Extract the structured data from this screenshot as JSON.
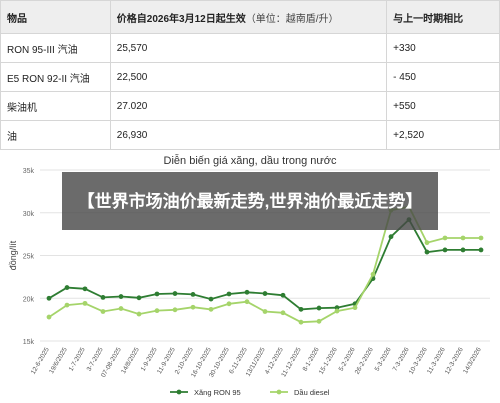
{
  "table": {
    "headers": {
      "product": "物品",
      "price": "价格自2026年3月12日起生效",
      "price_unit": "（单位：越南盾/升）",
      "change": "与上一时期相比"
    },
    "rows": [
      {
        "product": "RON 95-III 汽油",
        "price": "25,570",
        "change": "+330"
      },
      {
        "product": "E5 RON 92-II 汽油",
        "price": "22,500",
        "change": "- 450"
      },
      {
        "product": "柴油机",
        "price": "27.020",
        "change": "+550"
      },
      {
        "product": "油",
        "price": "26,930",
        "change": "+2,520"
      }
    ]
  },
  "overlay": {
    "text": "【世界市场油价最新走势,世界油价最近走势】"
  },
  "chart_data": {
    "type": "line",
    "title": "Diễn biến giá xăng, dầu trong nước",
    "ylabel": "đồng/lít",
    "xlabel": "",
    "ylim": [
      15000,
      35000
    ],
    "yticks": [
      "15k",
      "20k",
      "25k",
      "30k",
      "35k"
    ],
    "grid": true,
    "legend_position": "bottom",
    "categories": [
      "12-6-2025",
      "19/6/2025",
      "1-7-2025",
      "3-7-2025",
      "07-08-2025",
      "14/8/2025",
      "1-9-2025",
      "11-9-2025",
      "2-10-2025",
      "16-10-2025",
      "30-10-2025",
      "6-11-2025",
      "13/11/2025",
      "4-12-2025",
      "11-12-2025",
      "8-1-2026",
      "15-1-2026",
      "5-2-2026",
      "26-2-2026",
      "5-3-2026",
      "7-3-2026",
      "10-3-2026",
      "11-3-2026",
      "12-3-2026",
      "14/3/2026"
    ],
    "series": [
      {
        "name": "Xăng RON 95",
        "color": "#2e7d32",
        "values": [
          20000,
          21250,
          21100,
          20100,
          20200,
          20050,
          20500,
          20550,
          20450,
          19900,
          20500,
          20700,
          20550,
          20350,
          18700,
          18850,
          18900,
          19350,
          22300,
          27200,
          29200,
          25400,
          25650,
          25650,
          25650
        ]
      },
      {
        "name": "Dầu diesel",
        "color": "#a5d46a",
        "values": [
          17800,
          19200,
          19400,
          18450,
          18800,
          18150,
          18550,
          18650,
          18950,
          18700,
          19350,
          19600,
          18450,
          18300,
          17200,
          17300,
          18500,
          18900,
          22800,
          30300,
          30700,
          26500,
          27050,
          27050,
          27050
        ]
      }
    ]
  }
}
